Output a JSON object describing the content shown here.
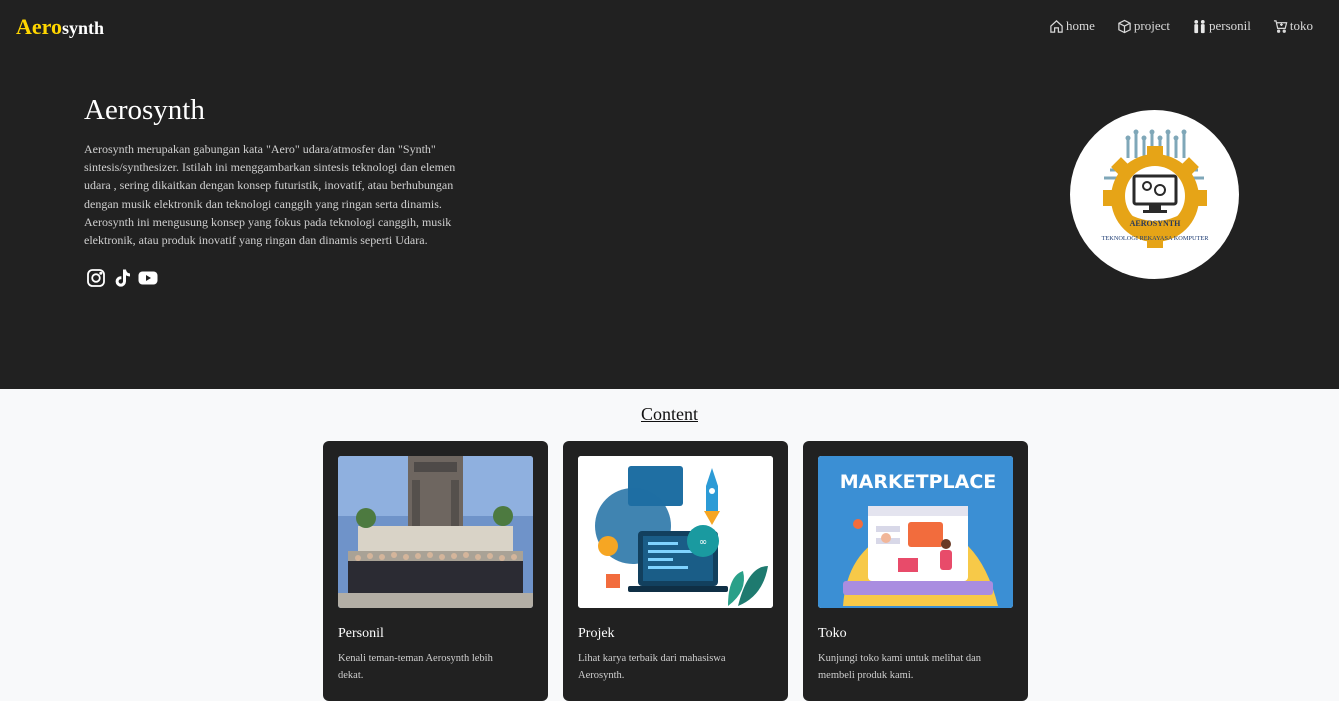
{
  "navbar": {
    "brand_part1": "Aero",
    "brand_part2": "synth",
    "items": [
      {
        "label": "home",
        "icon": "home-icon"
      },
      {
        "label": "project",
        "icon": "box-icon"
      },
      {
        "label": "personil",
        "icon": "people-icon"
      },
      {
        "label": "toko",
        "icon": "cart-icon"
      }
    ]
  },
  "hero": {
    "title": "Aerosynth",
    "description": "Aerosynth merupakan gabungan kata \"Aero\" udara/atmosfer dan \"Synth\" sintesis/synthesizer. Istilah ini menggambarkan sintesis teknologi dan elemen udara , sering dikaitkan dengan konsep futuristik, inovatif, atau berhubungan dengan musik elektronik dan teknologi canggih yang ringan serta dinamis. Aerosynth ini mengusung konsep yang fokus pada teknologi canggih, musik elektronik, atau produk inovatif yang ringan dan dinamis seperti Udara.",
    "socials": [
      "instagram-icon",
      "tiktok-icon",
      "youtube-icon"
    ],
    "logo": {
      "banner_text": "AEROSYNTH",
      "caption": "TEKNOLOGI REKAYASA KOMPUTER"
    }
  },
  "content": {
    "title": "Content",
    "cards": [
      {
        "title": "Personil",
        "text": "Kenali teman-teman Aerosynth lebih dekat."
      },
      {
        "title": "Projek",
        "text": "Lihat karya terbaik dari mahasiswa Aerosynth."
      },
      {
        "title": "Toko",
        "text": "Kunjungi toko kami untuk melihat dan membeli produk kami."
      }
    ],
    "marketplace_label": "MARKETPLACE"
  },
  "colors": {
    "dark_bg": "#212121",
    "brand_yellow": "#ffd600",
    "page_bg": "#f8f9fa",
    "logo_gold": "#e6a417"
  }
}
